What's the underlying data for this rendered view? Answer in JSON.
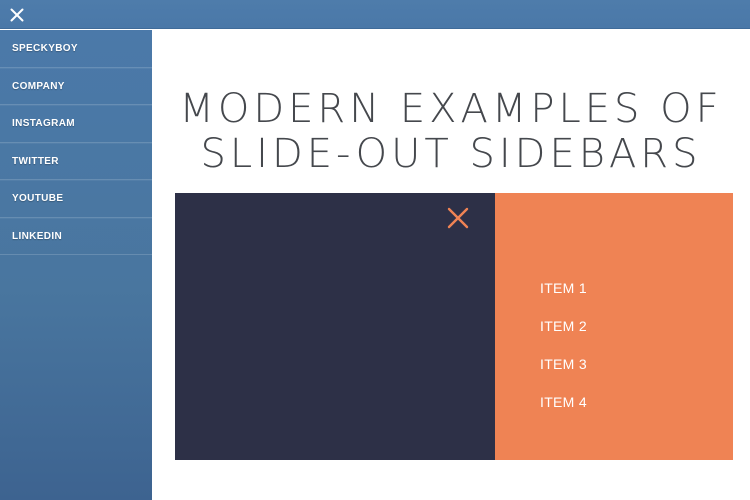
{
  "window": {
    "close_icon": "close-x-icon",
    "bar_color": "#4a78a8"
  },
  "sidebar": {
    "background_color": "#4b79a9",
    "items": [
      {
        "label": "SPECKYBOY"
      },
      {
        "label": "COMPANY"
      },
      {
        "label": "INSTAGRAM"
      },
      {
        "label": "TWITTER"
      },
      {
        "label": "YOUTUBE"
      },
      {
        "label": "LINKEDIN"
      }
    ]
  },
  "main": {
    "title": "MODERN EXAMPLES OF\nSLIDE-OUT SIDEBARS",
    "title_color": "#45484d"
  },
  "demo": {
    "dark_panel": {
      "background_color": "#2d3047",
      "close_icon": "close-x-icon",
      "close_icon_color": "#ef8354"
    },
    "orange_panel": {
      "background_color": "#ef8354",
      "menu_items": [
        {
          "label": "ITEM 1"
        },
        {
          "label": "ITEM 2"
        },
        {
          "label": "ITEM 3"
        },
        {
          "label": "ITEM 4"
        }
      ]
    }
  }
}
